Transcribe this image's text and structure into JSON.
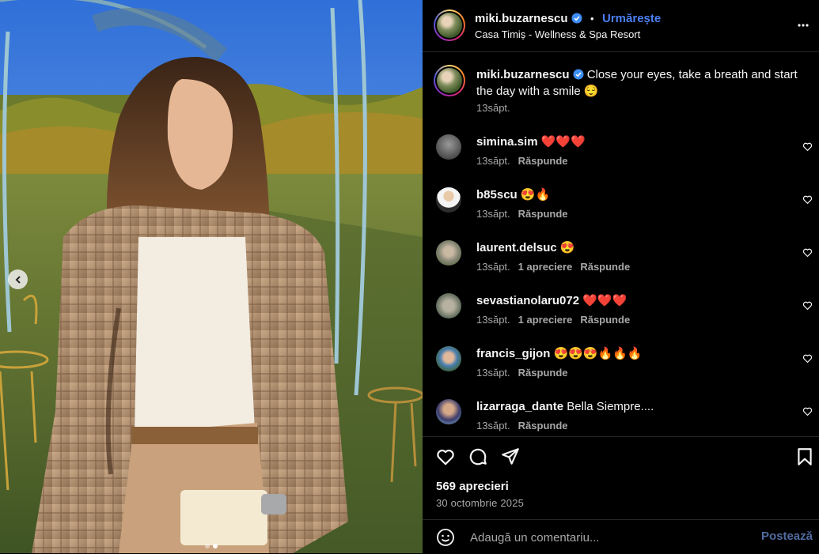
{
  "header": {
    "username": "miki.buzarnescu",
    "separator": "•",
    "follow_label": "Urmărește",
    "location": "Casa Timiș - Wellness & Spa Resort"
  },
  "caption": {
    "username": "miki.buzarnescu",
    "text": "Close your eyes, take a breath and start the day with a smile 😌",
    "time": "13săpt."
  },
  "comments": [
    {
      "username": "simina.sim",
      "text": "❤️❤️❤️",
      "time": "13săpt.",
      "likes": "",
      "reply": "Răspunde"
    },
    {
      "username": "b85scu",
      "text": "😍🔥",
      "time": "13săpt.",
      "likes": "",
      "reply": "Răspunde"
    },
    {
      "username": "laurent.delsuc",
      "text": "😍",
      "time": "13săpt.",
      "likes": "1 apreciere",
      "reply": "Răspunde"
    },
    {
      "username": "sevastianolaru072",
      "text": "❤️❤️❤️",
      "time": "13săpt.",
      "likes": "1 apreciere",
      "reply": "Răspunde"
    },
    {
      "username": "francis_gijon",
      "text": "😍😍😍🔥🔥🔥",
      "time": "13săpt.",
      "likes": "",
      "reply": "Răspunde"
    },
    {
      "username": "lizarraga_dante",
      "text": "Bella Siempre....",
      "time": "13săpt.",
      "likes": "",
      "reply": "Răspunde"
    }
  ],
  "post": {
    "likes_count": "569 aprecieri",
    "date": "30 octombrie 2025"
  },
  "compose": {
    "placeholder": "Adaugă un comentariu...",
    "post_label": "Postează"
  },
  "colors": {
    "background": "#000000",
    "follow_blue": "#4c7ff5",
    "muted_text": "#a8a8a8",
    "divider": "#262626"
  },
  "icons": [
    "chevron-left-icon",
    "verified-icon",
    "more-icon",
    "heart-icon",
    "comment-icon",
    "share-icon",
    "bookmark-icon",
    "emoji-icon"
  ],
  "carousel": {
    "slides": 2,
    "active": 2
  }
}
